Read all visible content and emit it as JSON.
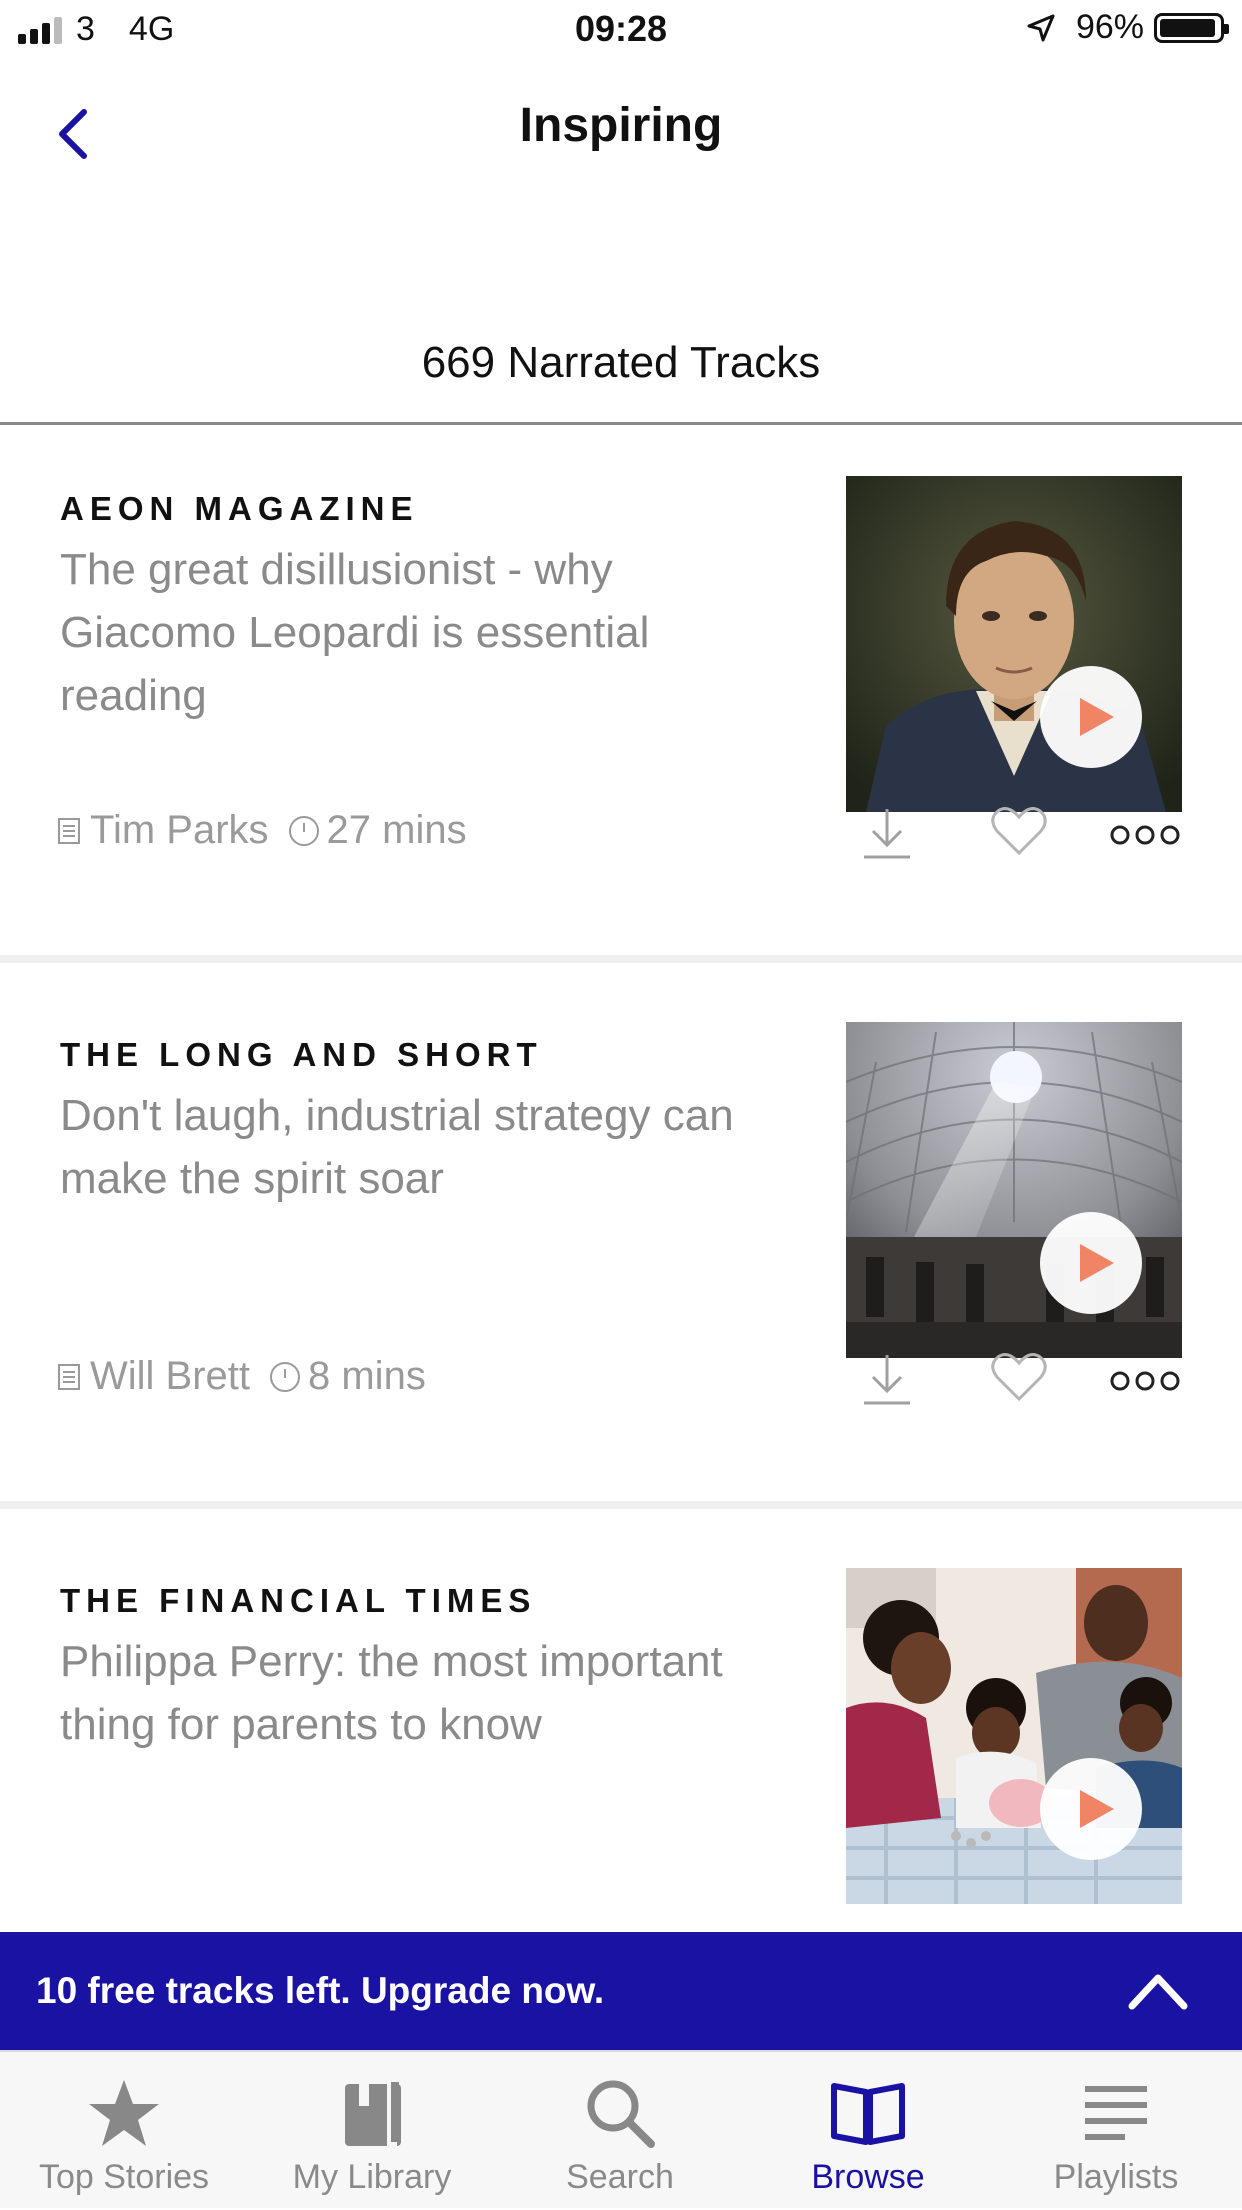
{
  "status_bar": {
    "carrier": "3",
    "network": "4G",
    "time": "09:28",
    "battery": "96%"
  },
  "header": {
    "title": "Inspiring",
    "back_icon": "chevron-left-icon"
  },
  "track_count": "669 Narrated Tracks",
  "tracks": [
    {
      "source": "AEON MAGAZINE",
      "title": "The great disillusionist - why Giacomo Leopardi is essential reading",
      "author": "Tim Parks",
      "duration": "27 mins",
      "image": "portrait-painting"
    },
    {
      "source": "THE LONG AND SHORT",
      "title": "Don't laugh, industrial strategy can make the spirit soar",
      "author": "Will Brett",
      "duration": "8 mins",
      "image": "pantheon-dome"
    },
    {
      "source": "THE FINANCIAL TIMES",
      "title": "Philippa Perry: the most important thing for parents to know",
      "author": "",
      "duration": "",
      "image": "family-piggy-bank"
    }
  ],
  "upgrade_banner": {
    "text": "10 free tracks left. Upgrade now."
  },
  "tabs": [
    {
      "label": "Top Stories",
      "icon": "star-icon"
    },
    {
      "label": "My Library",
      "icon": "library-icon"
    },
    {
      "label": "Search",
      "icon": "search-icon"
    },
    {
      "label": "Browse",
      "icon": "open-book-icon",
      "active": true
    },
    {
      "label": "Playlists",
      "icon": "list-icon"
    }
  ],
  "colors": {
    "accent": "#1a12a3",
    "play": "#f08464",
    "muted_text": "#8a8a8a"
  }
}
